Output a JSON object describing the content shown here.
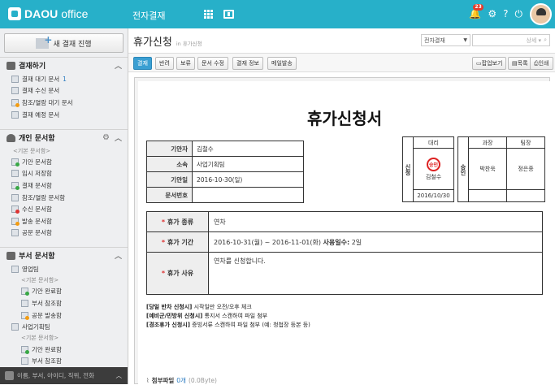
{
  "topbar": {
    "logo_brand": "DAOU",
    "logo_suffix": "office",
    "app_name": "전자결재",
    "notification_count": "23"
  },
  "sidebar": {
    "new_button": "새 결재 진행",
    "sections": {
      "approval": {
        "title": "결재하기",
        "items": [
          {
            "label": "결재 대기 문서",
            "count": "1"
          },
          {
            "label": "결재 수신 문서"
          },
          {
            "label": "참조/열람 대기 문서"
          },
          {
            "label": "결재 예정 문서"
          }
        ]
      },
      "personal": {
        "title": "개인 문서함",
        "group": "<기본 문서함>",
        "items": [
          {
            "label": "기안 문서함"
          },
          {
            "label": "임시 저장함"
          },
          {
            "label": "결재 문서함"
          },
          {
            "label": "참조/열람 문서함"
          },
          {
            "label": "수신 문서함"
          },
          {
            "label": "발송 문서함"
          },
          {
            "label": "공문 문서함"
          }
        ]
      },
      "dept": {
        "title": "부서 문서함",
        "dept1": "영업팀",
        "group": "<기본 문서함>",
        "items": [
          {
            "label": "기안 완료함"
          },
          {
            "label": "부서 참조함"
          },
          {
            "label": "공문 발송함"
          }
        ],
        "dept2": "사업기획팀",
        "group2": "<기본 문서함>",
        "items2": [
          {
            "label": "기안 완료함"
          },
          {
            "label": "부서 참조함"
          }
        ]
      }
    },
    "search_placeholder": "이름, 부서, 아이디, 직위, 전화"
  },
  "main": {
    "title": "휴가신청",
    "subtitle": "in 휴가신청",
    "select_value": "전자결재",
    "search_placeholder": "상세 ▾",
    "toolbar": {
      "approve": "결재",
      "reject": "반려",
      "hold": "보류",
      "edit": "문서 수정",
      "info": "결재 정보",
      "mail": "메일발송",
      "popup": "팝업보기",
      "list": "목록",
      "print": "인쇄"
    }
  },
  "document": {
    "title": "휴가신청서",
    "info": [
      {
        "key": "기안자",
        "value": "김철수"
      },
      {
        "key": "소속",
        "value": "사업기획팀"
      },
      {
        "key": "기안일",
        "value": "2016-10-30(일)"
      },
      {
        "key": "문서번호",
        "value": ""
      }
    ],
    "approval_label": "신청",
    "approval_role": "대리",
    "approval_stamp": "승인",
    "approval_name": "김철수",
    "approval_date": "2016/10/30",
    "approve_label": "승인",
    "approvers": [
      {
        "role": "과장",
        "name": "박찬욱"
      },
      {
        "role": "팀장",
        "name": "정은종"
      }
    ],
    "fields": {
      "type_label": "휴가 종류",
      "type_value": "연차",
      "period_label": "휴가 기간",
      "period_value": "2016-10-31(월) ~ 2016-11-01(화)",
      "days_label": "사용일수:",
      "days_value": "2일",
      "reason_label": "휴가 사유",
      "reason_value": "연차를 신청합니다."
    },
    "notes": [
      {
        "tag": "[당일 반차 신청시]",
        "text": "시작일만 오전/오후 체크"
      },
      {
        "tag": "[예비군/민방위 신청시]",
        "text": "통지서 스캔하여 파일 첨부"
      },
      {
        "tag": "[경조휴가 신청시]",
        "text": "증빙서류 스캔하여 파일 첨부 (예: 청첩장 등본 등)"
      }
    ],
    "attach_label": "첨부파일",
    "attach_count": "0개",
    "attach_size": "(0.0Byte)"
  },
  "colors": {
    "topbar": "#27b0c9",
    "active_button": "#3a9fd2",
    "stamp": "#dd2222"
  }
}
